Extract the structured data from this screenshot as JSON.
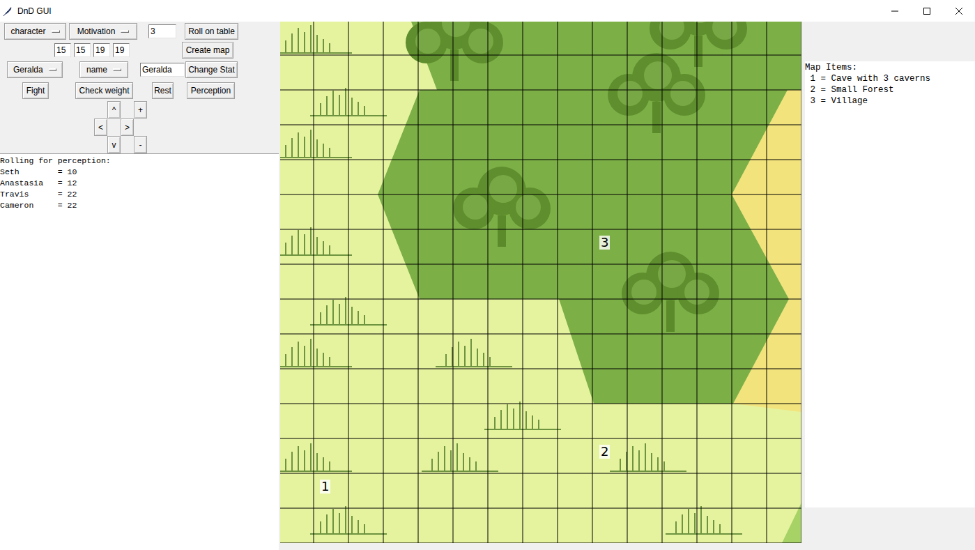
{
  "window": {
    "title": "DnD GUI"
  },
  "controls": {
    "row1": {
      "character_menu": "character",
      "table_menu": "Motivation",
      "roll_count": "3",
      "roll_button": "Roll on table"
    },
    "row2": {
      "map_sizes": [
        "15",
        "15",
        "19",
        "19"
      ],
      "create_button": "Create map"
    },
    "row3": {
      "character_menu": "Geralda",
      "stat_menu": "name",
      "stat_value": "Geralda",
      "change_button": "Change Stat"
    },
    "row4": [
      "Fight",
      "Check weight",
      "Rest",
      "Perception"
    ],
    "pad": [
      "^",
      "+",
      "<",
      ">",
      "v",
      "-"
    ]
  },
  "output": {
    "lines": [
      "Rolling for perception:",
      "Seth        = 10",
      "Anastasia   = 12",
      "Travis      = 22",
      "Cameron     = 22"
    ]
  },
  "map": {
    "pins": [
      {
        "label": "1"
      },
      {
        "label": "2"
      },
      {
        "label": "3"
      }
    ]
  },
  "map_items": {
    "title": "Map Items:",
    "lines": [
      " 1 = Cave with 3 caverns",
      " 2 = Small Forest",
      " 3 = Village"
    ]
  }
}
